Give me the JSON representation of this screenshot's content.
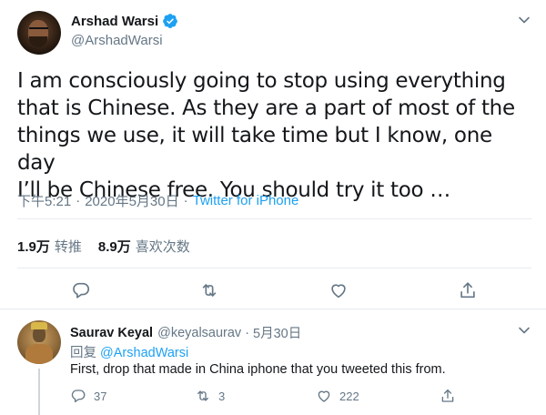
{
  "tweet": {
    "display_name": "Arshad Warsi",
    "handle": "@ArshadWarsi",
    "text_lines": [
      "I am consciously going to stop using everything",
      "that is Chinese. As they are a part of most of the",
      "things we use, it will take time but I know, one day",
      "I’ll be Chinese free. You should try it too …"
    ],
    "time": "下午5:21",
    "date": "2020年5月30日",
    "separator": "·",
    "source": "Twitter for iPhone",
    "stats": {
      "retweets_count": "1.9万",
      "retweets_label": "转推",
      "likes_count": "8.9万",
      "likes_label": "喜欢次数"
    },
    "icons": [
      "reply-icon",
      "retweet-icon",
      "like-icon",
      "share-icon"
    ]
  },
  "reply": {
    "display_name": "Saurav Keyal",
    "handle": "@keyalsaurav",
    "separator": "·",
    "date": "5月30日",
    "replying_label": "回复",
    "replying_to": "@ArshadWarsi",
    "text": "First, drop that made in China iphone that you tweeted this from.",
    "reply_count": "37",
    "retweet_count": "3",
    "like_count": "222"
  },
  "colors": {
    "accent": "#1da1f2",
    "secondary_text": "#657786",
    "primary_text": "#14171a",
    "divider": "#e6ecf0"
  }
}
